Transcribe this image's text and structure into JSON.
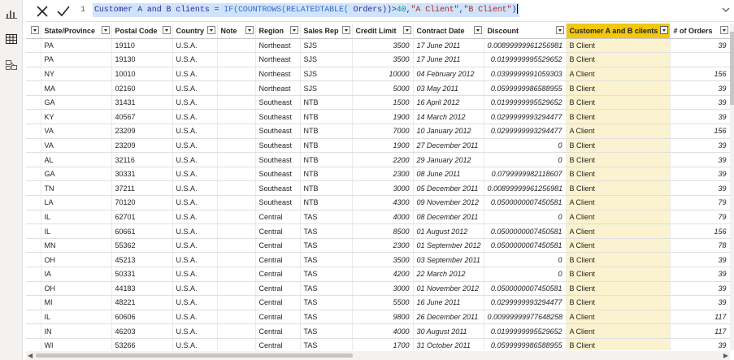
{
  "formula_bar": {
    "line_number": "1",
    "formula_prefix": "Customer A and B clients = ",
    "fn_if": "IF(",
    "fn_countrows": "COUNTROWS(",
    "fn_relatedtable": "RELATEDTABLE(",
    "arg": " Orders",
    "close_parens": "))>",
    "threshold": "40",
    "comma1": ",",
    "str_a": "\"A Client\"",
    "comma2": ",",
    "str_b": "\"B Client\"",
    "close": ")"
  },
  "icons": {
    "report_view": "bar-chart-icon",
    "data_view": "table-icon",
    "model_view": "model-icon",
    "cancel": "x-icon",
    "commit": "check-icon",
    "expand": "chevron-down-icon"
  },
  "table": {
    "columns": [
      "",
      "State/Province",
      "Postal Code",
      "Country",
      "Note",
      "Region",
      "Sales Rep",
      "Credit Limit",
      "Contract Date",
      "Discount",
      "Customer A and B clients",
      "# of Orders"
    ],
    "rows": [
      [
        "",
        "PA",
        "19110",
        "U.S.A.",
        "",
        "Northeast",
        "SJS",
        "3500",
        "17 June 2011",
        "0.00899999961256981",
        "B Client",
        "39"
      ],
      [
        "",
        "PA",
        "19130",
        "U.S.A.",
        "",
        "Northeast",
        "SJS",
        "3500",
        "17 June 2011",
        "0.0199999995529652",
        "B Client",
        ""
      ],
      [
        "",
        "NY",
        "10010",
        "U.S.A.",
        "",
        "Northeast",
        "SJS",
        "10000",
        "04 February 2012",
        "0.0399999991059303",
        "A Client",
        "156"
      ],
      [
        "",
        "MA",
        "02160",
        "U.S.A.",
        "",
        "Northeast",
        "SJS",
        "5000",
        "03 May 2011",
        "0.0599999986588955",
        "B Client",
        "39"
      ],
      [
        "",
        "GA",
        "31431",
        "U.S.A.",
        "",
        "Southeast",
        "NTB",
        "1500",
        "16 April 2012",
        "0.0199999995529652",
        "B Client",
        "39"
      ],
      [
        "",
        "KY",
        "40567",
        "U.S.A.",
        "",
        "Southeast",
        "NTB",
        "1900",
        "14 March 2012",
        "0.0299999993294477",
        "B Client",
        "39"
      ],
      [
        "",
        "VA",
        "23209",
        "U.S.A.",
        "",
        "Southeast",
        "NTB",
        "7000",
        "10 January 2012",
        "0.0299999993294477",
        "A Client",
        "156"
      ],
      [
        "",
        "VA",
        "23209",
        "U.S.A.",
        "",
        "Southeast",
        "NTB",
        "1900",
        "27 December 2011",
        "0",
        "B Client",
        "39"
      ],
      [
        "",
        "AL",
        "32116",
        "U.S.A.",
        "",
        "Southeast",
        "NTB",
        "2200",
        "29 January 2012",
        "0",
        "B Client",
        "39"
      ],
      [
        "",
        "GA",
        "30331",
        "U.S.A.",
        "",
        "Southeast",
        "NTB",
        "2300",
        "08 June 2011",
        "0.0799999982118607",
        "B Client",
        "39"
      ],
      [
        "",
        "TN",
        "37211",
        "U.S.A.",
        "",
        "Southeast",
        "NTB",
        "3000",
        "05 December 2011",
        "0.00899999961256981",
        "B Client",
        "39"
      ],
      [
        "",
        "LA",
        "70120",
        "U.S.A.",
        "",
        "Southeast",
        "NTB",
        "4300",
        "09 November 2012",
        "0.0500000007450581",
        "A Client",
        "79"
      ],
      [
        "",
        "IL",
        "62701",
        "U.S.A.",
        "",
        "Central",
        "TAS",
        "4000",
        "08 December 2011",
        "0",
        "A Client",
        "79"
      ],
      [
        "",
        "IL",
        "60661",
        "U.S.A.",
        "",
        "Central",
        "TAS",
        "8500",
        "01 August 2012",
        "0.0500000007450581",
        "A Client",
        "156"
      ],
      [
        "",
        "MN",
        "55362",
        "U.S.A.",
        "",
        "Central",
        "TAS",
        "2300",
        "01 September 2012",
        "0.0500000007450581",
        "A Client",
        "78"
      ],
      [
        "",
        "OH",
        "45213",
        "U.S.A.",
        "",
        "Central",
        "TAS",
        "3500",
        "03 September 2011",
        "0",
        "B Client",
        "39"
      ],
      [
        "",
        "IA",
        "50331",
        "U.S.A.",
        "",
        "Central",
        "TAS",
        "4200",
        "22 March 2012",
        "0",
        "B Client",
        "39"
      ],
      [
        "",
        "OH",
        "44183",
        "U.S.A.",
        "",
        "Central",
        "TAS",
        "3000",
        "01 November 2012",
        "0.0500000007450581",
        "B Client",
        "39"
      ],
      [
        "",
        "MI",
        "48221",
        "U.S.A.",
        "",
        "Central",
        "TAS",
        "5500",
        "16 June 2011",
        "0.0299999993294477",
        "B Client",
        "39"
      ],
      [
        "",
        "IL",
        "60606",
        "U.S.A.",
        "",
        "Central",
        "TAS",
        "9800",
        "26 December 2011",
        "0.00999999977648258",
        "A Client",
        "117"
      ],
      [
        "",
        "IN",
        "46203",
        "U.S.A.",
        "",
        "Central",
        "TAS",
        "4000",
        "30 August 2011",
        "0.0199999995529652",
        "A Client",
        "117"
      ],
      [
        "",
        "WI",
        "53266",
        "U.S.A.",
        "",
        "Central",
        "TAS",
        "1700",
        "31 October 2011",
        "0.0599999986588955",
        "B Client",
        "39"
      ]
    ]
  },
  "colors": {
    "selected_header": "#f2c811",
    "formula_highlight": "#cfe3fb"
  }
}
